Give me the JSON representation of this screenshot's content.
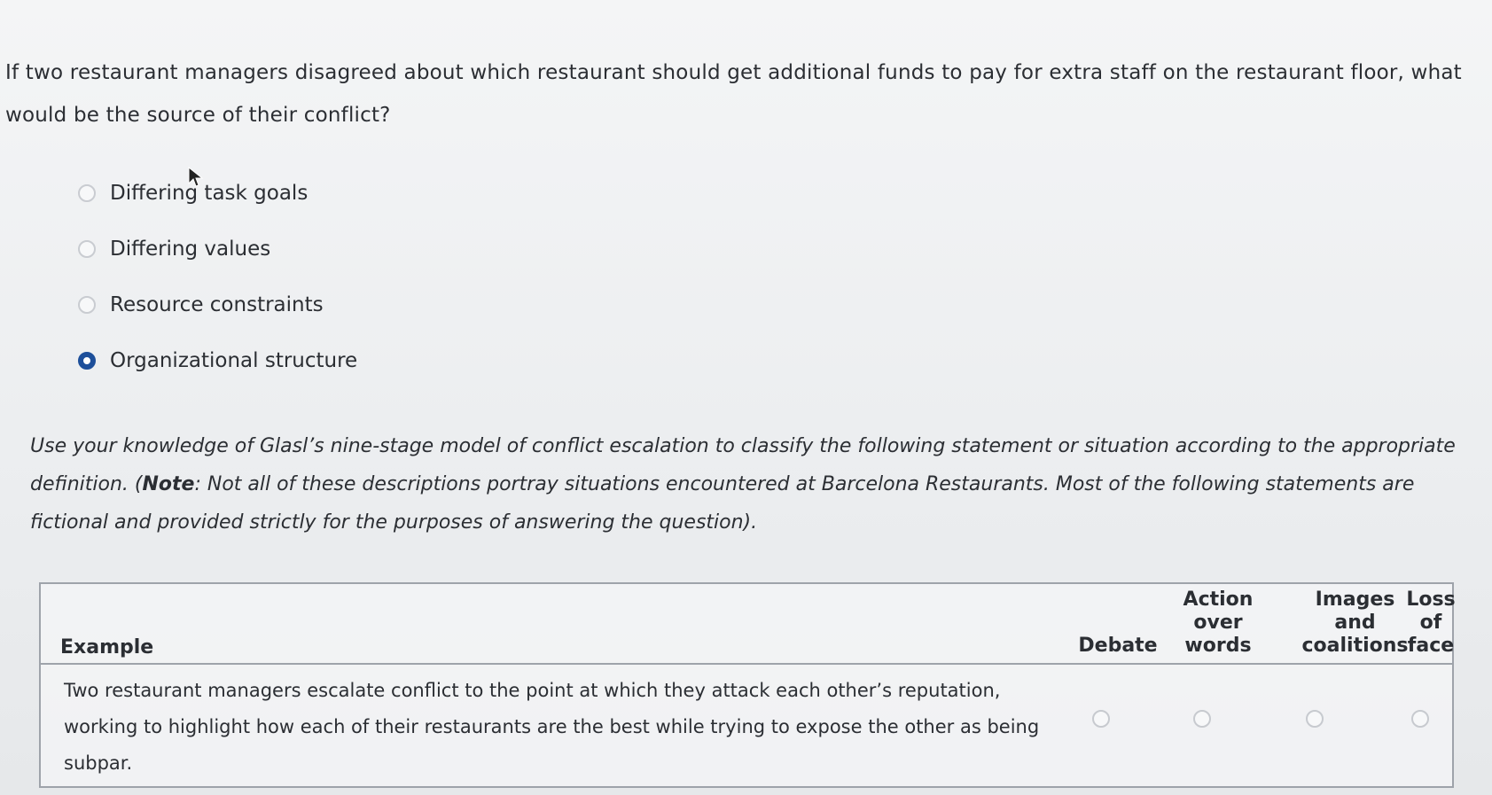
{
  "question1": {
    "text": "If two restaurant managers disagreed about which restaurant should get additional funds to pay for extra staff on the restaurant floor, what would be the source of their conflict?",
    "options": [
      {
        "label": "Differing task goals",
        "selected": false
      },
      {
        "label": "Differing values",
        "selected": false
      },
      {
        "label": "Resource constraints",
        "selected": false
      },
      {
        "label": "Organizational structure",
        "selected": true
      }
    ]
  },
  "question2": {
    "text_before": "Use your knowledge of Glasl’s nine-stage model of conflict escalation to classify the following statement or situation according to the appropriate definition. (",
    "note_label": "Note",
    "text_after": ": Not all of these descriptions portray situations encountered at Barcelona Restaurants. Most of the following statements are fictional and provided strictly for the purposes of answering the question)."
  },
  "table": {
    "headers": {
      "example": "Example",
      "debate": "Debate",
      "action": [
        "Action",
        "over",
        "words"
      ],
      "images": [
        "Images",
        "and",
        "coalitions"
      ],
      "loss": [
        "Loss",
        "of",
        "face"
      ]
    },
    "rows": [
      {
        "example": "Two restaurant managers escalate conflict to the point at which they attack each other’s reputation, working to highlight how each of their restaurants are the best while trying to expose the other as being subpar."
      }
    ]
  },
  "colors": {
    "selected_radio": "#1d4f9a",
    "text": "#2b2e33",
    "table_border": "#9ea3aa"
  }
}
